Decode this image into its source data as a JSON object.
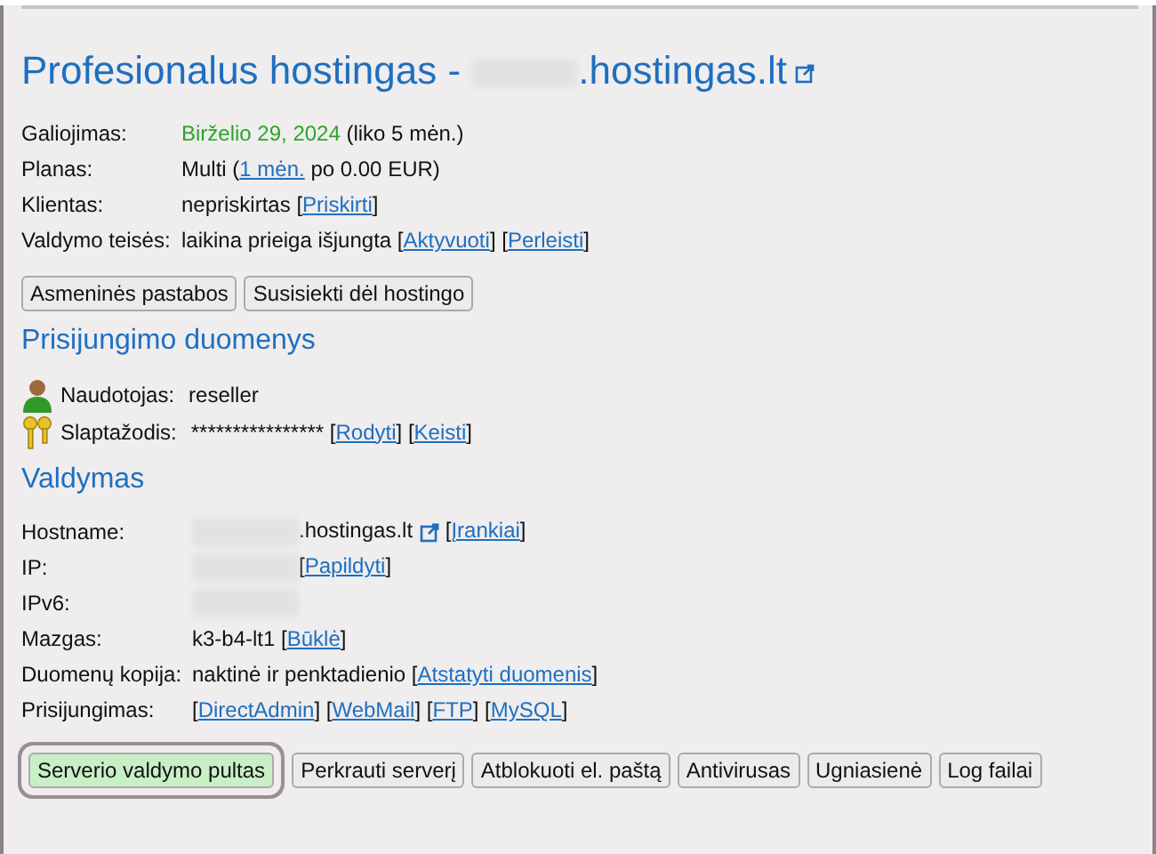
{
  "title": {
    "parts": [
      {
        "kind": "text",
        "text": "Profesionalus hostingas - "
      },
      {
        "kind": "redacted"
      },
      {
        "kind": "text",
        "text": ".hostingas.lt"
      },
      {
        "kind": "external"
      }
    ]
  },
  "info_rows": [
    {
      "label": "Galiojimas:",
      "parts": [
        {
          "kind": "date",
          "text": "Birželio 29, 2024"
        },
        {
          "kind": "text",
          "text": " (liko 5 mėn.)"
        }
      ]
    },
    {
      "label": "Planas:",
      "parts": [
        {
          "kind": "text",
          "text": "Multi ("
        },
        {
          "kind": "link",
          "text": "1 mėn."
        },
        {
          "kind": "text",
          "text": " po 0.00 EUR)"
        }
      ]
    },
    {
      "label": "Klientas:",
      "parts": [
        {
          "kind": "text",
          "text": "nepriskirtas ["
        },
        {
          "kind": "link",
          "text": "Priskirti"
        },
        {
          "kind": "text",
          "text": "]"
        }
      ]
    },
    {
      "label": "Valdymo teisės:",
      "parts": [
        {
          "kind": "text",
          "text": "laikina prieiga išjungta ["
        },
        {
          "kind": "link",
          "text": "Aktyvuoti"
        },
        {
          "kind": "text",
          "text": "] ["
        },
        {
          "kind": "link",
          "text": "Perleisti"
        },
        {
          "kind": "text",
          "text": "]"
        }
      ]
    }
  ],
  "top_buttons": [
    {
      "label": "Asmeninės pastabos",
      "selected": false
    },
    {
      "label": "Susisiekti dėl hostingo",
      "selected": false
    }
  ],
  "login_section": {
    "heading": "Prisijungimo duomenys",
    "rows": [
      {
        "kind": "user",
        "label": "Naudotojas:",
        "parts": [
          {
            "kind": "text",
            "text": "reseller"
          }
        ]
      },
      {
        "kind": "key",
        "label": "Slaptažodis:",
        "parts": [
          {
            "kind": "text",
            "text": "**************** ["
          },
          {
            "kind": "link",
            "text": "Rodyti"
          },
          {
            "kind": "text",
            "text": "] ["
          },
          {
            "kind": "link",
            "text": "Keisti"
          },
          {
            "kind": "text",
            "text": "]"
          }
        ]
      }
    ]
  },
  "management_section": {
    "heading": "Valdymas",
    "rows": [
      {
        "label": "Hostname:",
        "parts": [
          {
            "kind": "redacted"
          },
          {
            "kind": "text",
            "text": ".hostingas.lt"
          },
          {
            "kind": "external"
          },
          {
            "kind": "text",
            "text": " ["
          },
          {
            "kind": "link",
            "text": "Įrankiai"
          },
          {
            "kind": "text",
            "text": "]"
          }
        ]
      },
      {
        "label": "IP:",
        "parts": [
          {
            "kind": "redacted"
          },
          {
            "kind": "text",
            "text": "["
          },
          {
            "kind": "link",
            "text": "Papildyti"
          },
          {
            "kind": "text",
            "text": "]"
          }
        ]
      },
      {
        "label": "IPv6:",
        "parts": [
          {
            "kind": "redacted"
          }
        ]
      },
      {
        "label": "Mazgas:",
        "parts": [
          {
            "kind": "text",
            "text": "k3-b4-lt1 ["
          },
          {
            "kind": "link",
            "text": "Būklė"
          },
          {
            "kind": "text",
            "text": "]"
          }
        ]
      },
      {
        "label": "Duomenų kopija:",
        "parts": [
          {
            "kind": "text",
            "text": "naktinė ir penktadienio ["
          },
          {
            "kind": "link",
            "text": "Atstatyti duomenis"
          },
          {
            "kind": "text",
            "text": "]"
          }
        ]
      },
      {
        "label": "Prisijungimas:",
        "parts": [
          {
            "kind": "text",
            "text": "["
          },
          {
            "kind": "link",
            "text": "DirectAdmin"
          },
          {
            "kind": "text",
            "text": "] ["
          },
          {
            "kind": "link",
            "text": "WebMail"
          },
          {
            "kind": "text",
            "text": "] ["
          },
          {
            "kind": "link",
            "text": "FTP"
          },
          {
            "kind": "text",
            "text": "] ["
          },
          {
            "kind": "link",
            "text": "MySQL"
          },
          {
            "kind": "text",
            "text": "]"
          }
        ]
      }
    ]
  },
  "bottom_buttons": [
    {
      "label": "Serverio valdymo pultas",
      "selected": true
    },
    {
      "label": "Perkrauti serverį",
      "selected": false
    },
    {
      "label": "Atblokuoti el. paštą",
      "selected": false
    },
    {
      "label": "Antivirusas",
      "selected": false
    },
    {
      "label": "Ugniasienė",
      "selected": false
    },
    {
      "label": "Log failai",
      "selected": false
    }
  ]
}
